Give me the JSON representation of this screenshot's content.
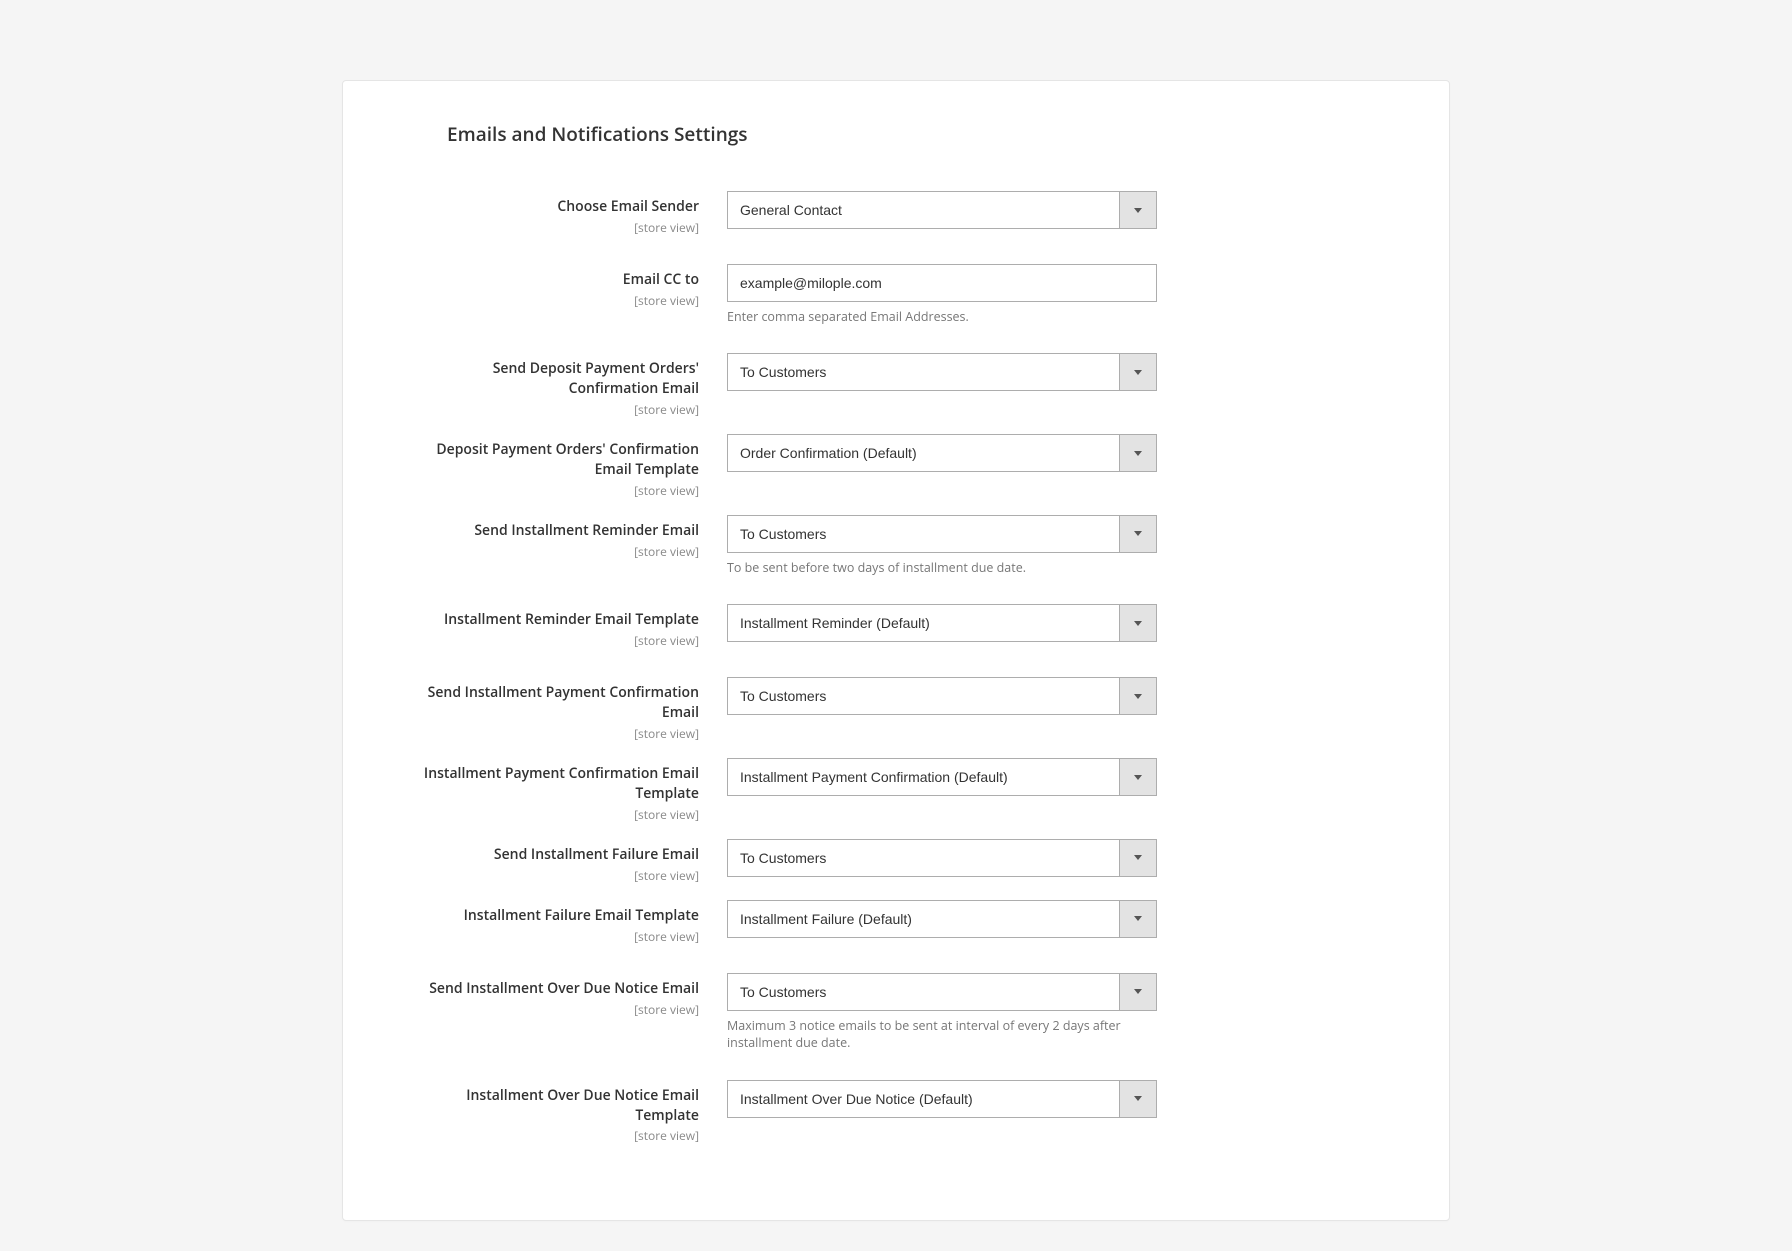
{
  "section": {
    "title": "Emails and Notifications Settings",
    "scope_label": "[store view]"
  },
  "fields": {
    "email_sender": {
      "label": "Choose Email Sender",
      "value": "General Contact"
    },
    "email_cc": {
      "label": "Email CC to",
      "value": "example@milople.com",
      "help": "Enter comma separated Email Addresses."
    },
    "deposit_confirm_send": {
      "label": "Send Deposit Payment Orders' Confirmation Email",
      "value": "To Customers"
    },
    "deposit_confirm_template": {
      "label": "Deposit Payment Orders' Confirmation Email Template",
      "value": "Order Confirmation (Default)"
    },
    "installment_reminder_send": {
      "label": "Send Installment Reminder Email",
      "value": "To Customers",
      "help": "To be sent before two days of installment due date."
    },
    "installment_reminder_template": {
      "label": "Installment Reminder Email Template",
      "value": "Installment Reminder (Default)"
    },
    "installment_payment_confirm_send": {
      "label": "Send Installment Payment Confirmation Email",
      "value": "To Customers"
    },
    "installment_payment_confirm_template": {
      "label": "Installment Payment Confirmation Email Template",
      "value": "Installment Payment Confirmation (Default)"
    },
    "installment_failure_send": {
      "label": "Send Installment Failure Email",
      "value": "To Customers"
    },
    "installment_failure_template": {
      "label": "Installment Failure Email Template",
      "value": "Installment Failure (Default)"
    },
    "installment_overdue_send": {
      "label": "Send Installment Over Due Notice Email",
      "value": "To Customers",
      "help": "Maximum 3 notice emails to be sent at interval of every 2 days after installment due date."
    },
    "installment_overdue_template": {
      "label": "Installment Over Due Notice Email Template",
      "value": "Installment Over Due Notice (Default)"
    }
  }
}
